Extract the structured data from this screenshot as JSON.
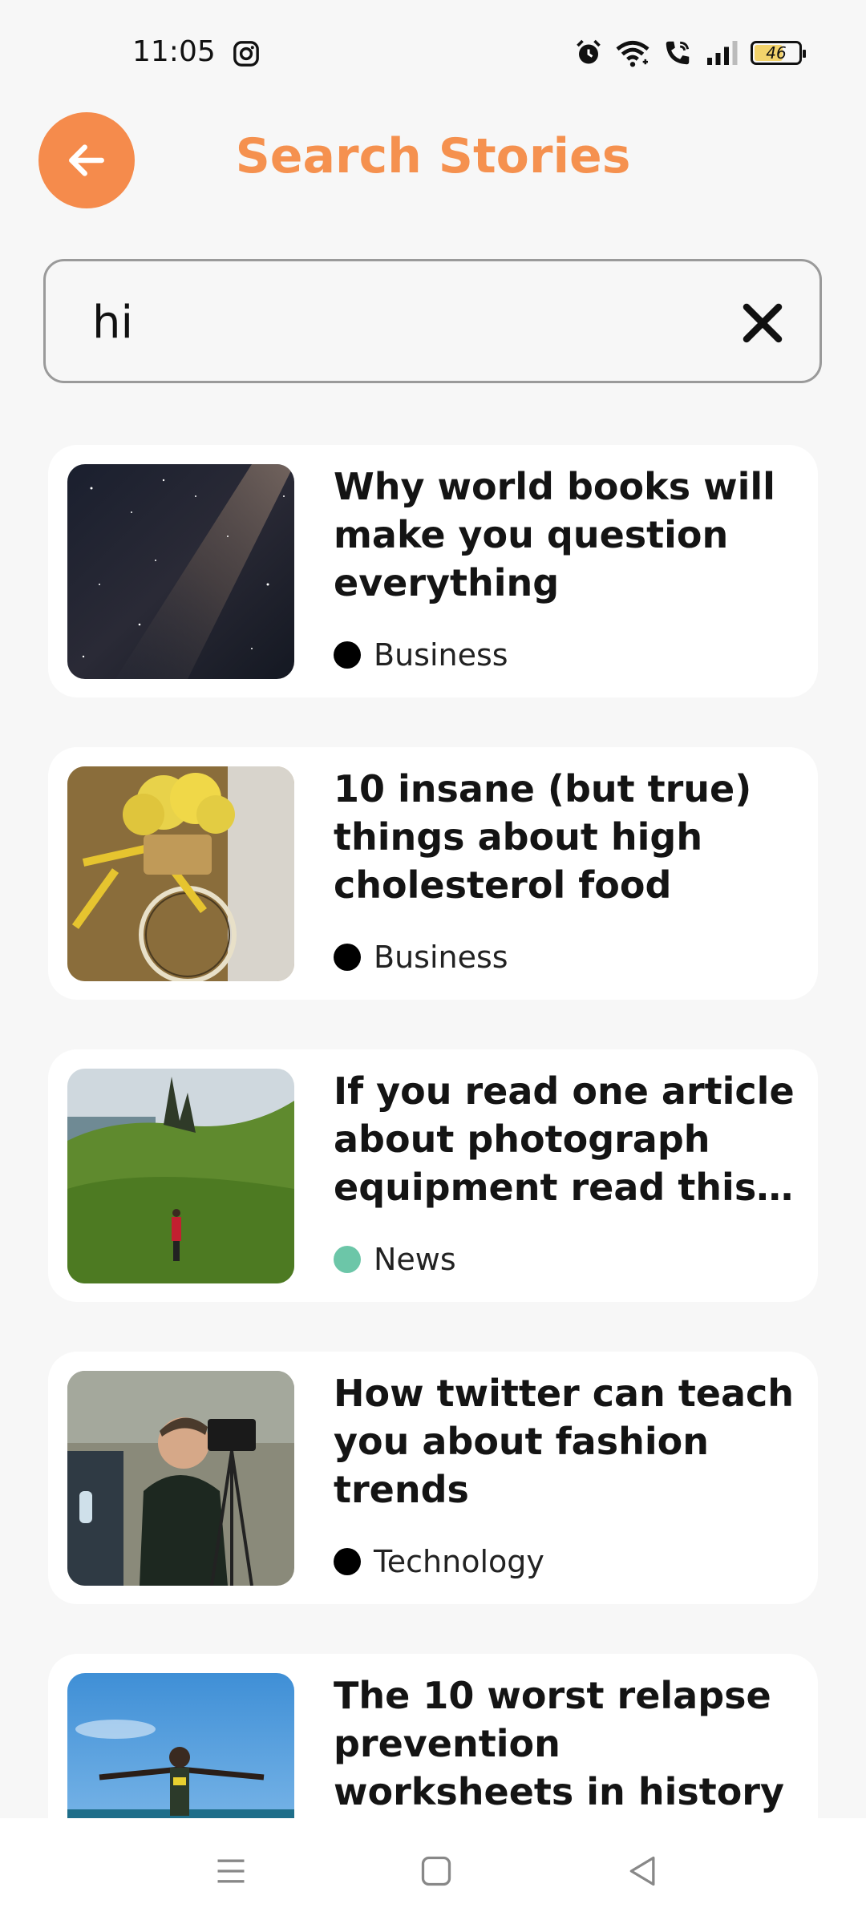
{
  "status_bar": {
    "time": "11:05",
    "battery": "46",
    "icons": [
      "instagram-icon",
      "alarm-icon",
      "wifi-icon",
      "wifi-call-icon",
      "signal-icon",
      "battery-icon"
    ]
  },
  "header": {
    "title": "Search Stories",
    "back_icon": "arrow-left-icon",
    "accent_color": "#f58b4c"
  },
  "search": {
    "value": "hi",
    "clear_icon": "close-icon"
  },
  "stories": [
    {
      "title": "Why world books will make you question everything",
      "category": "Business",
      "category_color": "#000000",
      "image": "starry-night-sky"
    },
    {
      "title": "10 insane (but true) things about high cholesterol food",
      "category": "Business",
      "category_color": "#000000",
      "image": "yellow-bicycle-flowers"
    },
    {
      "title": "If you read one article about photograph equipment read this ...",
      "category": "News",
      "category_color": "#6cc6a8",
      "image": "green-hills-hiker"
    },
    {
      "title": "How twitter can teach you about fashion trends",
      "category": "Technology",
      "category_color": "#000000",
      "image": "news-interview-camera"
    },
    {
      "title": "The 10 worst relapse prevention worksheets in history",
      "category": "",
      "category_color": "#000000",
      "image": "man-arms-outstretched-beach"
    }
  ],
  "nav_bar": {
    "icons": [
      "menu-icon",
      "home-square-icon",
      "back-triangle-icon"
    ]
  }
}
